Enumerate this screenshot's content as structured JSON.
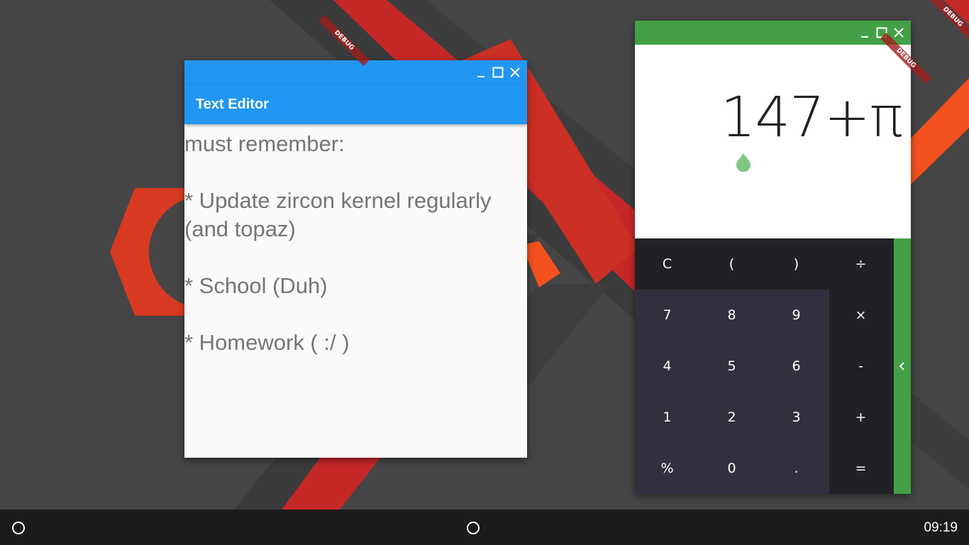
{
  "desktop": {
    "debug_label": "DEBUG"
  },
  "editor": {
    "title": "Text Editor",
    "debug_label": "DEBUG",
    "content": "must remember:\n\n* Update zircon kernel regularly (and topaz)\n\n* School (Duh)\n\n* Homework ( :/ )",
    "titlebar_color": "#2196f3"
  },
  "calculator": {
    "expression": "147+π",
    "debug_label": "DEBUG",
    "accent_color": "#43a047",
    "keys": [
      [
        "C",
        "(",
        ")",
        "÷"
      ],
      [
        "7",
        "8",
        "9",
        "×"
      ],
      [
        "4",
        "5",
        "6",
        "-"
      ],
      [
        "1",
        "2",
        "3",
        "+"
      ],
      [
        "%",
        "0",
        ".",
        "="
      ]
    ]
  },
  "window_controls": [
    "minimize-icon",
    "maximize-icon",
    "close-icon"
  ],
  "taskbar": {
    "clock": "09:19"
  }
}
